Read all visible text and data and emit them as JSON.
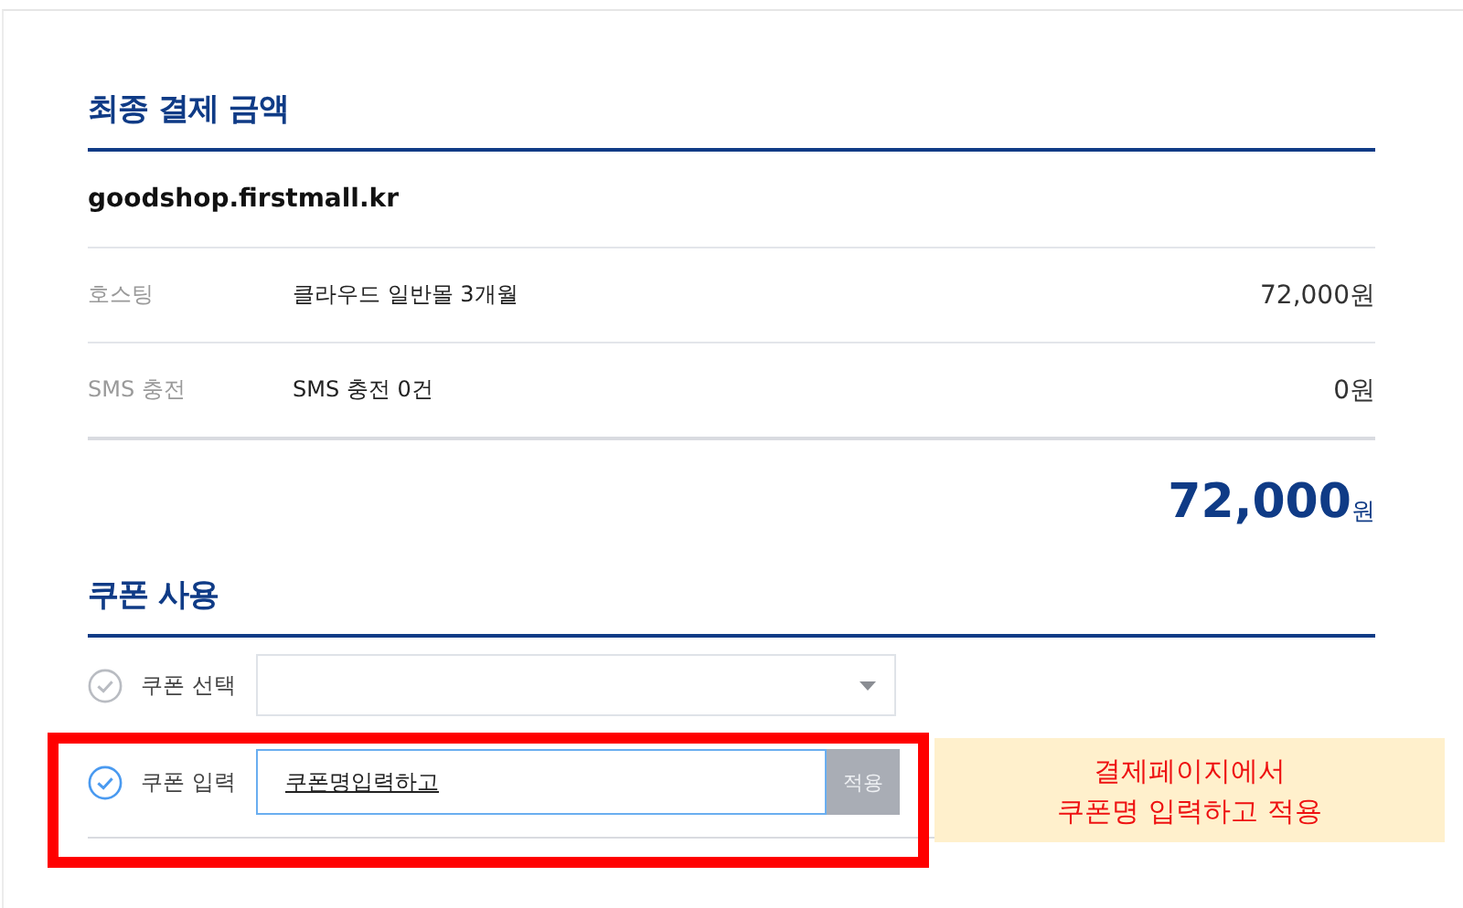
{
  "payment_summary": {
    "title": "최종 결제 금액",
    "domain": "goodshop.firstmall.kr",
    "items": [
      {
        "label": "호스팅",
        "description": "클라우드 일반몰 3개월",
        "amount": "72,000원"
      },
      {
        "label": "SMS 충전",
        "description": "SMS 충전 0건",
        "amount": "0원"
      }
    ],
    "total": {
      "amount": "72,000",
      "unit": "원"
    }
  },
  "coupon": {
    "title": "쿠폰 사용",
    "options": [
      {
        "kind": "select",
        "label": "쿠폰 선택",
        "selected": false
      },
      {
        "kind": "input",
        "label": "쿠폰 입력",
        "selected": true,
        "value": "쿠폰명입력하고",
        "button": "적용"
      }
    ]
  },
  "annotation": {
    "lines": [
      "결제페이지에서",
      "쿠폰명 입력하고 적용"
    ]
  }
}
